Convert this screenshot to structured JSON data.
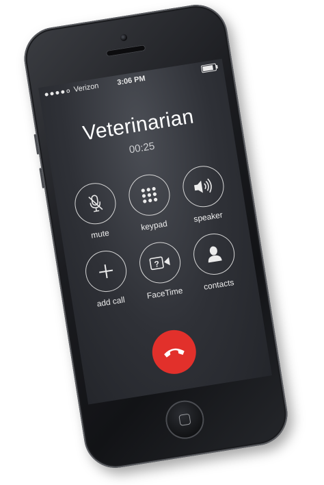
{
  "status_bar": {
    "carrier": "Verizon",
    "signal_bars_filled": 4,
    "signal_bars_total": 5,
    "time": "3:06 PM",
    "battery_icon": "battery-full-icon"
  },
  "call": {
    "caller_name": "Veterinarian",
    "duration": "00:25"
  },
  "controls": [
    {
      "key": "mute",
      "label": "mute",
      "icon": "microphone-slash-icon"
    },
    {
      "key": "keypad",
      "label": "keypad",
      "icon": "keypad-grid-icon"
    },
    {
      "key": "speaker",
      "label": "speaker",
      "icon": "speaker-icon"
    },
    {
      "key": "add_call",
      "label": "add call",
      "icon": "plus-icon"
    },
    {
      "key": "facetime",
      "label": "FaceTime",
      "icon": "facetime-icon"
    },
    {
      "key": "contacts",
      "label": "contacts",
      "icon": "person-icon"
    }
  ],
  "end_call": {
    "icon": "phone-hangup-icon"
  },
  "colors": {
    "end_call_red": "#e2302b",
    "screen_bg": "#2f3137",
    "text_white": "#ffffff"
  }
}
